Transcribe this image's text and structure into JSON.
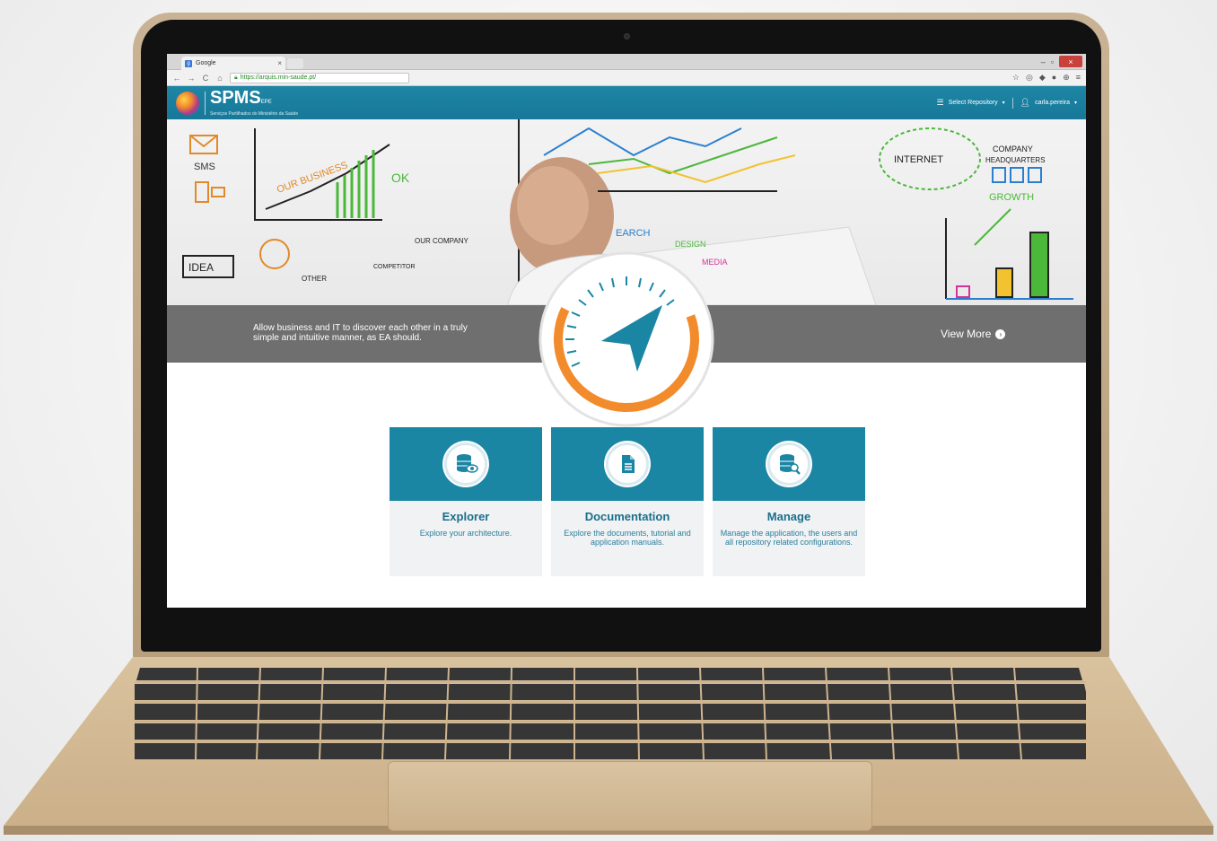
{
  "browser": {
    "tab_title": "Google",
    "url": "https://arquis.min-saude.pt/"
  },
  "header": {
    "logo_title": "SPMS",
    "logo_suffix": "EPE",
    "logo_subtitle": "Serviços Partilhados do Ministério da Saúde",
    "select_repository": "Select Repository",
    "username": "carla.pereira"
  },
  "hero": {
    "caption": "Allow business and IT to discover each other in a truly simple and intuitive manner, as EA should.",
    "view_more": "View More"
  },
  "cards": [
    {
      "title": "Explorer",
      "description": "Explore your architecture.",
      "icon": "database-eye-icon"
    },
    {
      "title": "Documentation",
      "description": "Explore the documents, tutorial and application manuals.",
      "icon": "document-icon"
    },
    {
      "title": "Manage",
      "description": "Manage the application, the users and all repository related configurations.",
      "icon": "database-wrench-icon"
    }
  ],
  "colors": {
    "header_teal": "#1e86a6",
    "card_teal": "#1b86a4",
    "compass_orange": "#f28b2b",
    "band_gray": "#6f6f6f"
  }
}
